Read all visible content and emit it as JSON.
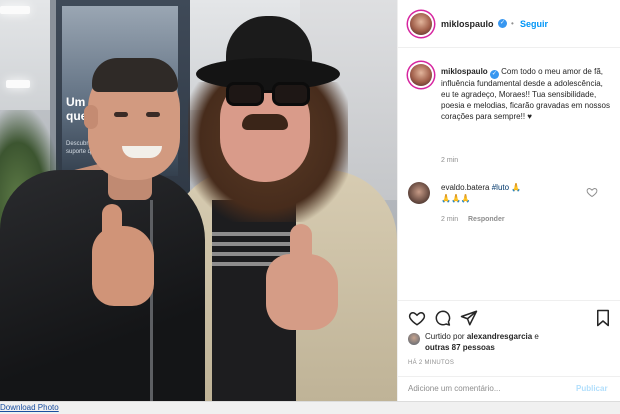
{
  "post": {
    "username": "miklospaulo",
    "follow_label": "Seguir",
    "separator": "•",
    "verified_mark": "✓",
    "caption_user": "miklospaulo",
    "caption_text": "Com todo o meu amor de fã, influência fundamental desde a adolescência, eu te agradeço, Moraes!! Tua sensibilidade, poesia e melodias, ficarão gravadas em nossos corações para sempre!! ♥",
    "caption_time": "2 min",
    "comment_user": "evaldo.batera",
    "comment_hashtag": "#luto",
    "comment_emoji": "🙏",
    "comment_emojis_line": "🙏🙏🙏",
    "comment_time": "2 min",
    "reply_label": "Responder",
    "liked_prefix": "Curtido por",
    "liked_user": "alexandresgarcia",
    "liked_middle": "e",
    "liked_others": "outras 87 pessoas",
    "posted_time": "HÁ 2 MINUTOS",
    "comment_placeholder": "Adicione um comentário...",
    "publish_label": "Publicar"
  },
  "photo": {
    "poster_headline": "Um es que suá",
    "poster_small": "Descubra o suporte que"
  },
  "footer": {
    "download_label": "Download Photo"
  },
  "icons": {
    "like": "heart-icon",
    "comment": "comment-icon",
    "share": "share-icon",
    "save": "bookmark-icon"
  },
  "colors": {
    "accent": "#0095f6",
    "verified": "#3897f0",
    "muted": "#8e8e8e",
    "publish_disabled": "#b2dffc",
    "hashtag": "#00376b"
  }
}
